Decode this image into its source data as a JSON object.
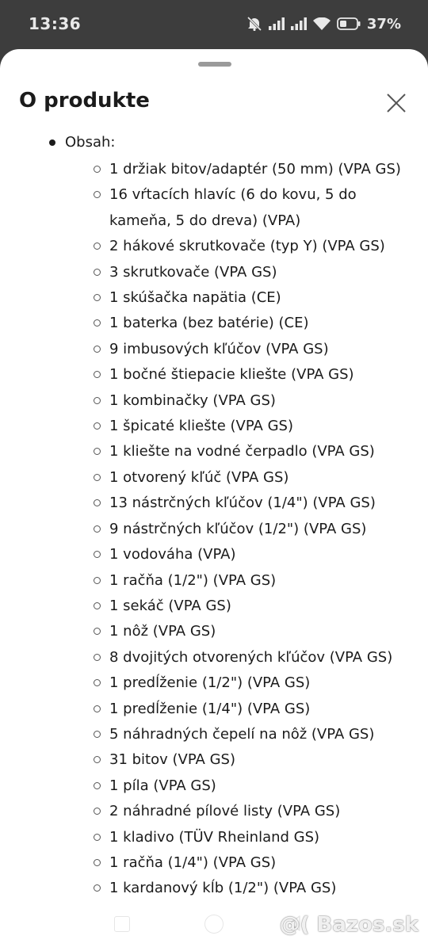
{
  "status_bar": {
    "time": "13:36",
    "battery_percent": "37%",
    "icons": [
      "mute-icon",
      "signal-icon",
      "signal-icon",
      "wifi-icon",
      "battery-icon"
    ]
  },
  "sheet": {
    "title": "O produkte",
    "close_icon": "close-icon",
    "top_item_label": "Obsah:",
    "items": [
      "1 držiak bitov/adaptér (50 mm) (VPA GS)",
      "16 vŕtacích hlavíc (6 do kovu, 5 do kameňa, 5 do dreva) (VPA)",
      "2 hákové skrutkovače (typ Y) (VPA GS)",
      "3 skrutkovače (VPA GS)",
      "1 skúšačka napätia (CE)",
      "1 baterka (bez batérie) (CE)",
      "9 imbusových kľúčov (VPA GS)",
      "1 bočné štiepacie kliešte (VPA GS)",
      "1 kombinačky (VPA GS)",
      "1 špicaté kliešte (VPA GS)",
      "1 kliešte na vodné čerpadlo (VPA GS)",
      "1 otvorený kľúč (VPA GS)",
      "13 nástrčných kľúčov (1/4\") (VPA GS)",
      "9 nástrčných kľúčov (1/2\") (VPA GS)",
      "1 vodováha (VPA)",
      "1 račňa (1/2\") (VPA GS)",
      "1 sekáč (VPA GS)",
      "1 nôž (VPA GS)",
      "8 dvojitých otvorených kľúčov (VPA GS)",
      "1 predĺženie (1/2\") (VPA GS)",
      "1 predĺženie (1/4\") (VPA GS)",
      "5 náhradných čepelí na nôž (VPA GS)",
      "31 bitov (VPA GS)",
      "1 píla (VPA GS)",
      "2 náhradné pílové listy (VPA GS)",
      "1 kladivo (TÜV Rheinland GS)",
      "1 račňa (1/4\") (VPA GS)",
      "1 kardanový kĺb (1/2\") (VPA GS)"
    ]
  },
  "nav_bar": {
    "buttons": [
      "recents-button",
      "home-button",
      "back-button"
    ]
  },
  "watermark": {
    "text": "@( Bazos.sk"
  }
}
